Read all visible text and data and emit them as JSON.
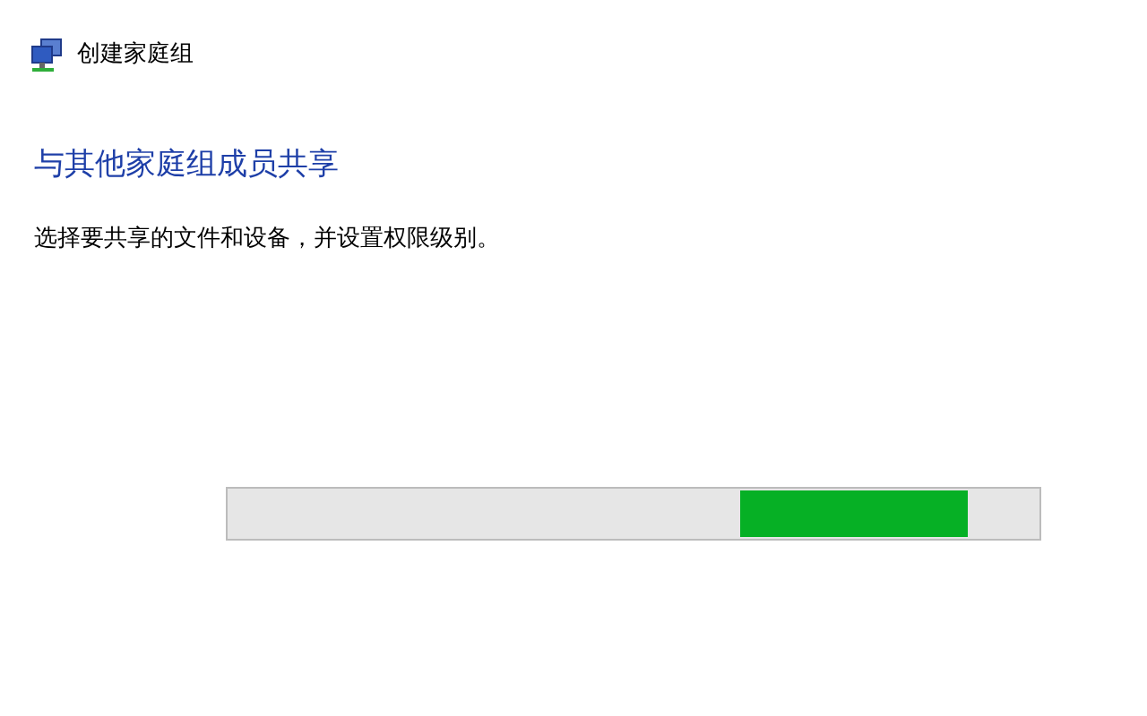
{
  "window": {
    "title": "创建家庭组"
  },
  "heading": "与其他家庭组成员共享",
  "description": "选择要共享的文件和设备，并设置权限级别。"
}
